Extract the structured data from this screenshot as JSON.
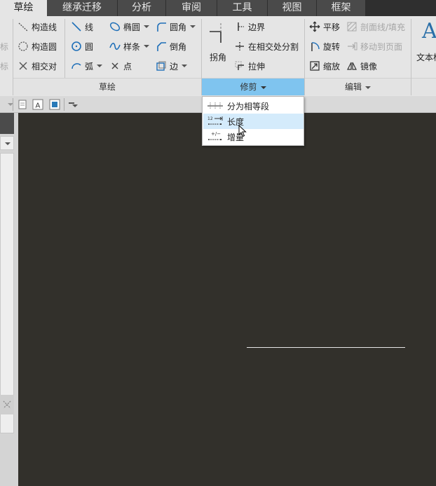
{
  "tabs": [
    {
      "label": "草绘",
      "active": true
    },
    {
      "label": "继承迁移"
    },
    {
      "label": "分析"
    },
    {
      "label": "审阅"
    },
    {
      "label": "工具"
    },
    {
      "label": "视图"
    },
    {
      "label": "框架"
    }
  ],
  "left_cut": {
    "item1": "标",
    "item2": "标"
  },
  "sketch_group": {
    "label": "草绘",
    "construction_line": "构造线",
    "construction_circle": "构造圆",
    "intersection": "相交对",
    "line": "线",
    "circle": "圆",
    "arc": "弧",
    "ellipse": "椭圆",
    "spline": "样条",
    "point": "点",
    "fillet": "圆角",
    "chamfer": "倒角",
    "edge": "边"
  },
  "trim_group": {
    "label": "修剪",
    "corner": "拐角",
    "boundary": "边界",
    "split_at_intersection": "在相交处分割",
    "stretch": "拉伸"
  },
  "edit_group": {
    "label": "编辑",
    "translate": "平移",
    "section_fill": "剖面线/填充",
    "rotate": "旋转",
    "move_to_page": "移动到页面",
    "scale": "缩放",
    "mirror": "镜像"
  },
  "text_group": {
    "label": "文本框"
  },
  "menu": {
    "items": [
      {
        "label": "分为相等段"
      },
      {
        "label": "长度",
        "hover": true
      },
      {
        "label": "增量"
      }
    ]
  },
  "colors": {
    "accent": "#7fc4ef",
    "menu_hover": "#d4ebfb",
    "canvas": "#32302b",
    "tab_dark": "#4a4a4a"
  }
}
